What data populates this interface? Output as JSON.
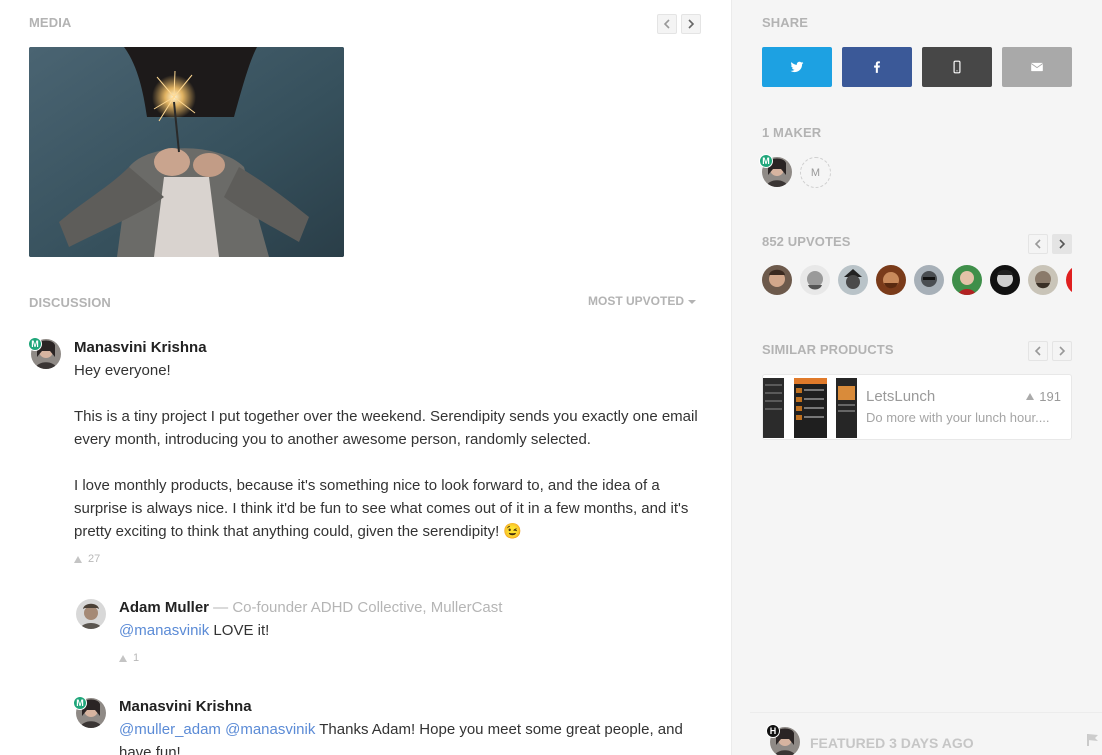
{
  "media": {
    "title": "MEDIA"
  },
  "discussion": {
    "title": "DISCUSSION",
    "sort_label": "MOST UPVOTED"
  },
  "comments": [
    {
      "author": "Manasvini Krishna",
      "badge": "M",
      "paragraphs": [
        "Hey everyone!",
        "This is a tiny project I put together over the weekend. Serendipity sends you exactly one email every month, introducing you to another awesome person, randomly selected.",
        "I love monthly products, because it's something nice to look forward to, and the idea of a surprise is always nice. I think it'd be fun to see what comes out of it in a few months, and it's pretty exciting to think that anything could, given the serendipity! 😉"
      ],
      "votes": "27"
    },
    {
      "author": "Adam Muller",
      "role": " — Co-founder ADHD Collective, MullerCast",
      "mention": "@manasvinik",
      "text": " LOVE it!",
      "votes": "1"
    },
    {
      "author": "Manasvini Krishna",
      "badge": "M",
      "mention": "@muller_adam @manasvinik",
      "text": " Thanks Adam! Hope you meet some great people, and have fun!"
    }
  ],
  "share": {
    "title": "SHARE",
    "buttons": [
      {
        "icon": "twitter-icon",
        "color": "#1da1e2"
      },
      {
        "icon": "facebook-icon",
        "color": "#3b5998"
      },
      {
        "icon": "phone-icon",
        "color": "#474747"
      },
      {
        "icon": "mail-icon",
        "color": "#a9a9a9"
      }
    ]
  },
  "makers": {
    "title": "1 MAKER",
    "badge": "M",
    "slot_label": "M"
  },
  "upvotes": {
    "title": "852 UPVOTES"
  },
  "similar": {
    "title": "SIMILAR PRODUCTS",
    "items": [
      {
        "name": "LetsLunch",
        "tagline": "Do more with your lunch hour....",
        "votes": "191"
      }
    ]
  },
  "featured": {
    "label": "FEATURED 3 DAYS AGO",
    "badge": "H"
  },
  "colors": {
    "accent_green": "#1fa67a",
    "mention_blue": "#5b8bd6",
    "sidebar_bg": "#f5f5f5"
  }
}
